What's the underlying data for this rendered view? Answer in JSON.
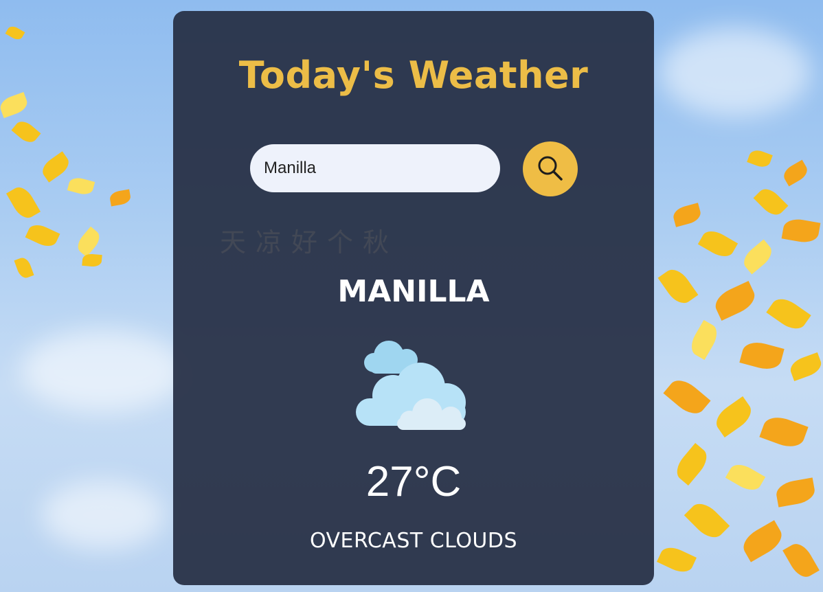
{
  "app": {
    "title": "Today's Weather"
  },
  "search": {
    "value": "Manilla",
    "button_icon": "search-icon"
  },
  "watermark_text": "天凉好个秋",
  "weather": {
    "city": "MANILLA",
    "icon": "overcast-clouds-icon",
    "temperature": "27°C",
    "description": "OVERCAST CLOUDS"
  },
  "colors": {
    "accent": "#ecbd47",
    "card_bg": "#262e44",
    "input_bg": "#eef2fb"
  }
}
